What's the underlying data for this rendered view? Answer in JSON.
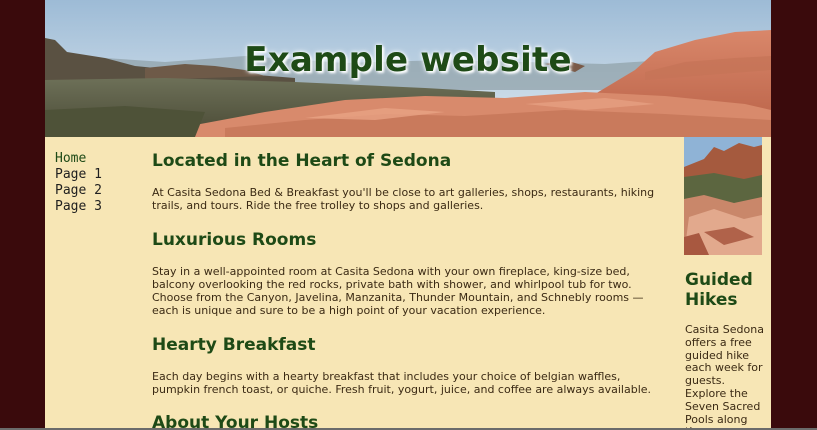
{
  "header": {
    "title": "Example website"
  },
  "nav": {
    "items": [
      "Home",
      "Page 1",
      "Page 2",
      "Page 3"
    ]
  },
  "main": {
    "sections": [
      {
        "heading": "Located in the Heart of Sedona",
        "text": "At Casita Sedona Bed & Breakfast you'll be close to art galleries, shops, restaurants, hiking trails, and tours. Ride the free trolley to shops and galleries."
      },
      {
        "heading": "Luxurious Rooms",
        "text": "Stay in a well-appointed room at Casita Sedona with your own fireplace, king-size bed, balcony overlooking the red rocks, private bath with shower, and whirlpool tub for two. Choose from the Canyon, Javelina, Manzanita, Thunder Mountain, and Schnebly rooms — each is unique and sure to be a high point of your vacation experience."
      },
      {
        "heading": "Hearty Breakfast",
        "text": "Each day begins with a hearty breakfast that includes your choice of belgian waffles, pumpkin french toast, or quiche. Fresh fruit, yogurt, juice, and coffee are always available."
      },
      {
        "heading": "About Your Hosts",
        "text": ""
      }
    ]
  },
  "aside": {
    "heading": "Guided Hikes",
    "text": "Casita Sedona offers a free guided hike each week for guests. Explore the Seven Sacred Pools along the"
  },
  "colors": {
    "page_background": "#3a0a0c",
    "content_background": "#f7e6b5",
    "heading_green": "#1e4a16",
    "body_text": "#3b2a14"
  }
}
